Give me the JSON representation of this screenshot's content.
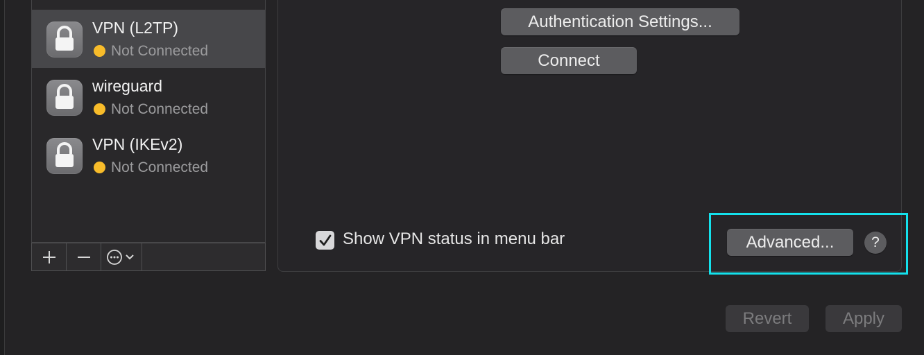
{
  "services": [
    {
      "name": "VPN (L2TP)",
      "status": "Not Connected",
      "selected": true
    },
    {
      "name": "wireguard",
      "status": "Not Connected",
      "selected": false
    },
    {
      "name": "VPN (IKEv2)",
      "status": "Not Connected",
      "selected": false
    }
  ],
  "list_toolbar": {
    "add_icon": "plus-icon",
    "remove_icon": "minus-icon",
    "action_icon": "ellipsis-circle-icon"
  },
  "detail": {
    "auth_settings_label": "Authentication Settings...",
    "connect_label": "Connect",
    "show_vpn_status_label": "Show VPN status in menu bar",
    "show_vpn_status_checked": true,
    "advanced_label": "Advanced...",
    "help_label": "?"
  },
  "footer": {
    "revert_label": "Revert",
    "apply_label": "Apply"
  },
  "colors": {
    "status_dot": "#f8bc2a",
    "highlight": "#14e1ec",
    "selected_row": "#47474a"
  }
}
